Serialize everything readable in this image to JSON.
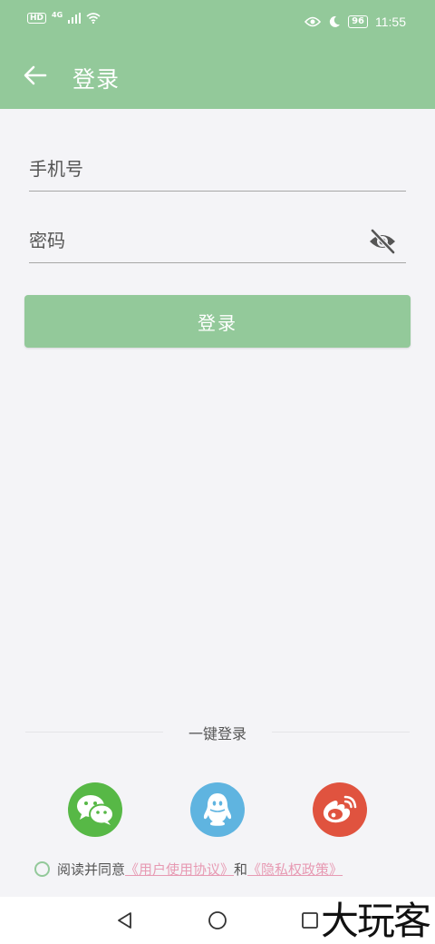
{
  "status_bar": {
    "hd": "HD",
    "network": "4G",
    "battery": "96",
    "time": "11:55"
  },
  "header": {
    "title": "登录"
  },
  "form": {
    "phone_placeholder": "手机号",
    "password_placeholder": "密码",
    "login_button": "登录"
  },
  "one_click": {
    "label": "一键登录",
    "providers": [
      "wechat-icon",
      "qq-icon",
      "weibo-icon"
    ]
  },
  "agreement": {
    "prefix": "阅读并同意",
    "user_agreement": "《用户使用协议》",
    "conjunction": "和",
    "privacy_policy": "《隐私权政策》"
  },
  "watermark": "大玩客",
  "colors": {
    "primary": "#93c99a",
    "link": "#e79ab3",
    "wechat": "#57b846",
    "qq": "#5fb4e0",
    "weibo": "#e0533f"
  }
}
